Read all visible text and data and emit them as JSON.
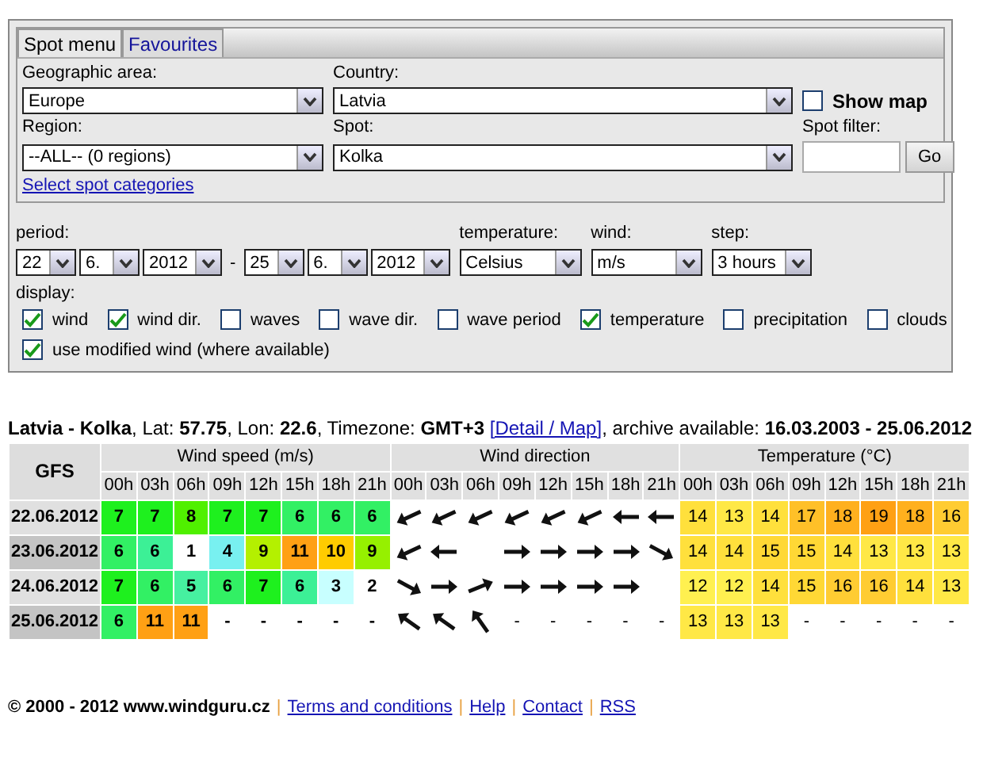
{
  "tabs": [
    {
      "label": "Spot menu",
      "selected": true
    },
    {
      "label": "Favourites",
      "selected": false
    }
  ],
  "spot_menu": {
    "geographic_area": {
      "label": "Geographic area:",
      "value": "Europe"
    },
    "country": {
      "label": "Country:",
      "value": "Latvia"
    },
    "show_map": {
      "label": "Show map",
      "checked": false
    },
    "region": {
      "label": "Region:",
      "value": "--ALL-- (0 regions)"
    },
    "spot": {
      "label": "Spot:",
      "value": "Kolka"
    },
    "spot_filter": {
      "label": "Spot filter:"
    },
    "go_button": "Go",
    "categories_link": "Select spot categories"
  },
  "options": {
    "period": {
      "label": "period:",
      "from": [
        "22",
        "6.",
        "2012"
      ],
      "separator": "-",
      "to": [
        "25",
        "6.",
        "2012"
      ]
    },
    "temperature": {
      "label": "temperature:",
      "value": "Celsius"
    },
    "wind": {
      "label": "wind:",
      "value": "m/s"
    },
    "step": {
      "label": "step:",
      "value": "3 hours"
    },
    "display_label": "display:",
    "display": [
      {
        "label": "wind",
        "checked": true
      },
      {
        "label": "wind dir.",
        "checked": true
      },
      {
        "label": "waves",
        "checked": false
      },
      {
        "label": "wave dir.",
        "checked": false
      },
      {
        "label": "wave period",
        "checked": false
      },
      {
        "label": "temperature",
        "checked": true
      },
      {
        "label": "precipitation",
        "checked": false
      },
      {
        "label": "clouds",
        "checked": false
      }
    ],
    "modified_wind": {
      "label": "use modified wind (where available)",
      "checked": true
    }
  },
  "forecast": {
    "info_before": "**Latvia - Kolka**,  Lat: **57.75**, Lon: **22.6**, Timezone: **GMT+3**",
    "detail_link": "[Detail / Map]",
    "info_after": ", archive available: **16.03.2003 - 25.06.2012**",
    "model": "GFS",
    "groups": [
      {
        "title": "Wind speed (m/s)",
        "hours": [
          "00h",
          "03h",
          "06h",
          "09h",
          "12h",
          "15h",
          "18h",
          "21h"
        ]
      },
      {
        "title": "Wind direction",
        "hours": [
          "00h",
          "03h",
          "06h",
          "09h",
          "12h",
          "15h",
          "18h",
          "21h"
        ]
      },
      {
        "title": "Temperature (°C)",
        "hours": [
          "00h",
          "03h",
          "06h",
          "09h",
          "12h",
          "15h",
          "18h",
          "21h"
        ]
      }
    ],
    "rows": [
      {
        "date": "22.06.2012",
        "wind": [
          {
            "text": "7",
            "color": "#1ef01e"
          },
          {
            "text": "7",
            "color": "#1ef01e"
          },
          {
            "text": "8",
            "color": "#50f000"
          },
          {
            "text": "7",
            "color": "#1ef01e"
          },
          {
            "text": "7",
            "color": "#1ef01e"
          },
          {
            "text": "6",
            "color": "#32f064"
          },
          {
            "text": "6",
            "color": "#32f064"
          },
          {
            "text": "6",
            "color": "#32f064"
          }
        ],
        "direction": [
          {
            "kind": "sw"
          },
          {
            "kind": "sw"
          },
          {
            "kind": "sw"
          },
          {
            "kind": "sw"
          },
          {
            "kind": "sw"
          },
          {
            "kind": "sw"
          },
          {
            "kind": "w"
          },
          {
            "kind": "w"
          }
        ],
        "temperature": [
          {
            "text": "14",
            "color": "#ffe03c"
          },
          {
            "text": "13",
            "color": "#ffe846"
          },
          {
            "text": "14",
            "color": "#ffe03c"
          },
          {
            "text": "17",
            "color": "#ffc028"
          },
          {
            "text": "18",
            "color": "#ffb01e"
          },
          {
            "text": "19",
            "color": "#ffa014"
          },
          {
            "text": "18",
            "color": "#ffb01e"
          },
          {
            "text": "16",
            "color": "#ffcc32"
          }
        ]
      },
      {
        "date": "23.06.2012",
        "wind": [
          {
            "text": "6",
            "color": "#32f064"
          },
          {
            "text": "6",
            "color": "#3cf096"
          },
          {
            "text": "1",
            "color": "#ffffff"
          },
          {
            "text": "4",
            "color": "#78f0f0"
          },
          {
            "text": "9",
            "color": "#b4f000"
          },
          {
            "text": "11",
            "color": "#ffa014"
          },
          {
            "text": "10",
            "color": "#ffcc00"
          },
          {
            "text": "9",
            "color": "#96f000"
          }
        ],
        "direction": [
          {
            "kind": "sw"
          },
          {
            "kind": "w"
          },
          {
            "kind": "blank"
          },
          {
            "kind": "e"
          },
          {
            "kind": "e"
          },
          {
            "kind": "e"
          },
          {
            "kind": "e"
          },
          {
            "kind": "se"
          }
        ],
        "temperature": [
          {
            "text": "14",
            "color": "#ffe03c"
          },
          {
            "text": "14",
            "color": "#ffe03c"
          },
          {
            "text": "15",
            "color": "#ffd835"
          },
          {
            "text": "15",
            "color": "#ffd835"
          },
          {
            "text": "14",
            "color": "#ffe03c"
          },
          {
            "text": "13",
            "color": "#ffe846"
          },
          {
            "text": "13",
            "color": "#ffe846"
          },
          {
            "text": "13",
            "color": "#ffe846"
          }
        ]
      },
      {
        "date": "24.06.2012",
        "wind": [
          {
            "text": "7",
            "color": "#1ef01e"
          },
          {
            "text": "6",
            "color": "#32f064"
          },
          {
            "text": "5",
            "color": "#46f0a0"
          },
          {
            "text": "6",
            "color": "#32f064"
          },
          {
            "text": "7",
            "color": "#1ef01e"
          },
          {
            "text": "6",
            "color": "#3cf096"
          },
          {
            "text": "3",
            "color": "#c8ffff"
          },
          {
            "text": "2",
            "color": "#ffffff"
          }
        ],
        "direction": [
          {
            "kind": "se"
          },
          {
            "kind": "e"
          },
          {
            "kind": "ne"
          },
          {
            "kind": "e"
          },
          {
            "kind": "e"
          },
          {
            "kind": "e"
          },
          {
            "kind": "e"
          },
          {
            "kind": "blank"
          }
        ],
        "temperature": [
          {
            "text": "12",
            "color": "#fff050"
          },
          {
            "text": "12",
            "color": "#fff050"
          },
          {
            "text": "14",
            "color": "#ffe03c"
          },
          {
            "text": "15",
            "color": "#ffd835"
          },
          {
            "text": "16",
            "color": "#ffcc32"
          },
          {
            "text": "16",
            "color": "#ffcc32"
          },
          {
            "text": "14",
            "color": "#ffe03c"
          },
          {
            "text": "13",
            "color": "#ffe846"
          }
        ]
      },
      {
        "date": "25.06.2012",
        "wind": [
          {
            "text": "6",
            "color": "#32f064"
          },
          {
            "text": "11",
            "color": "#ffa014"
          },
          {
            "text": "11",
            "color": "#ffa014"
          },
          {
            "text": "-"
          },
          {
            "text": "-"
          },
          {
            "text": "-"
          },
          {
            "text": "-"
          },
          {
            "text": "-"
          }
        ],
        "direction": [
          {
            "kind": "nw"
          },
          {
            "kind": "nw"
          },
          {
            "kind": "nnw"
          },
          {
            "text": "-"
          },
          {
            "text": "-"
          },
          {
            "text": "-"
          },
          {
            "text": "-"
          },
          {
            "text": "-"
          }
        ],
        "temperature": [
          {
            "text": "13",
            "color": "#ffe846"
          },
          {
            "text": "13",
            "color": "#ffe846"
          },
          {
            "text": "13",
            "color": "#ffe846"
          },
          {
            "text": "-"
          },
          {
            "text": "-"
          },
          {
            "text": "-"
          },
          {
            "text": "-"
          },
          {
            "text": "-"
          }
        ]
      }
    ]
  },
  "footer": {
    "copyright": "© 2000 - 2012 www.windguru.cz",
    "separator": "|",
    "links": [
      "Terms and conditions",
      "Help",
      "Contact",
      "RSS"
    ]
  }
}
